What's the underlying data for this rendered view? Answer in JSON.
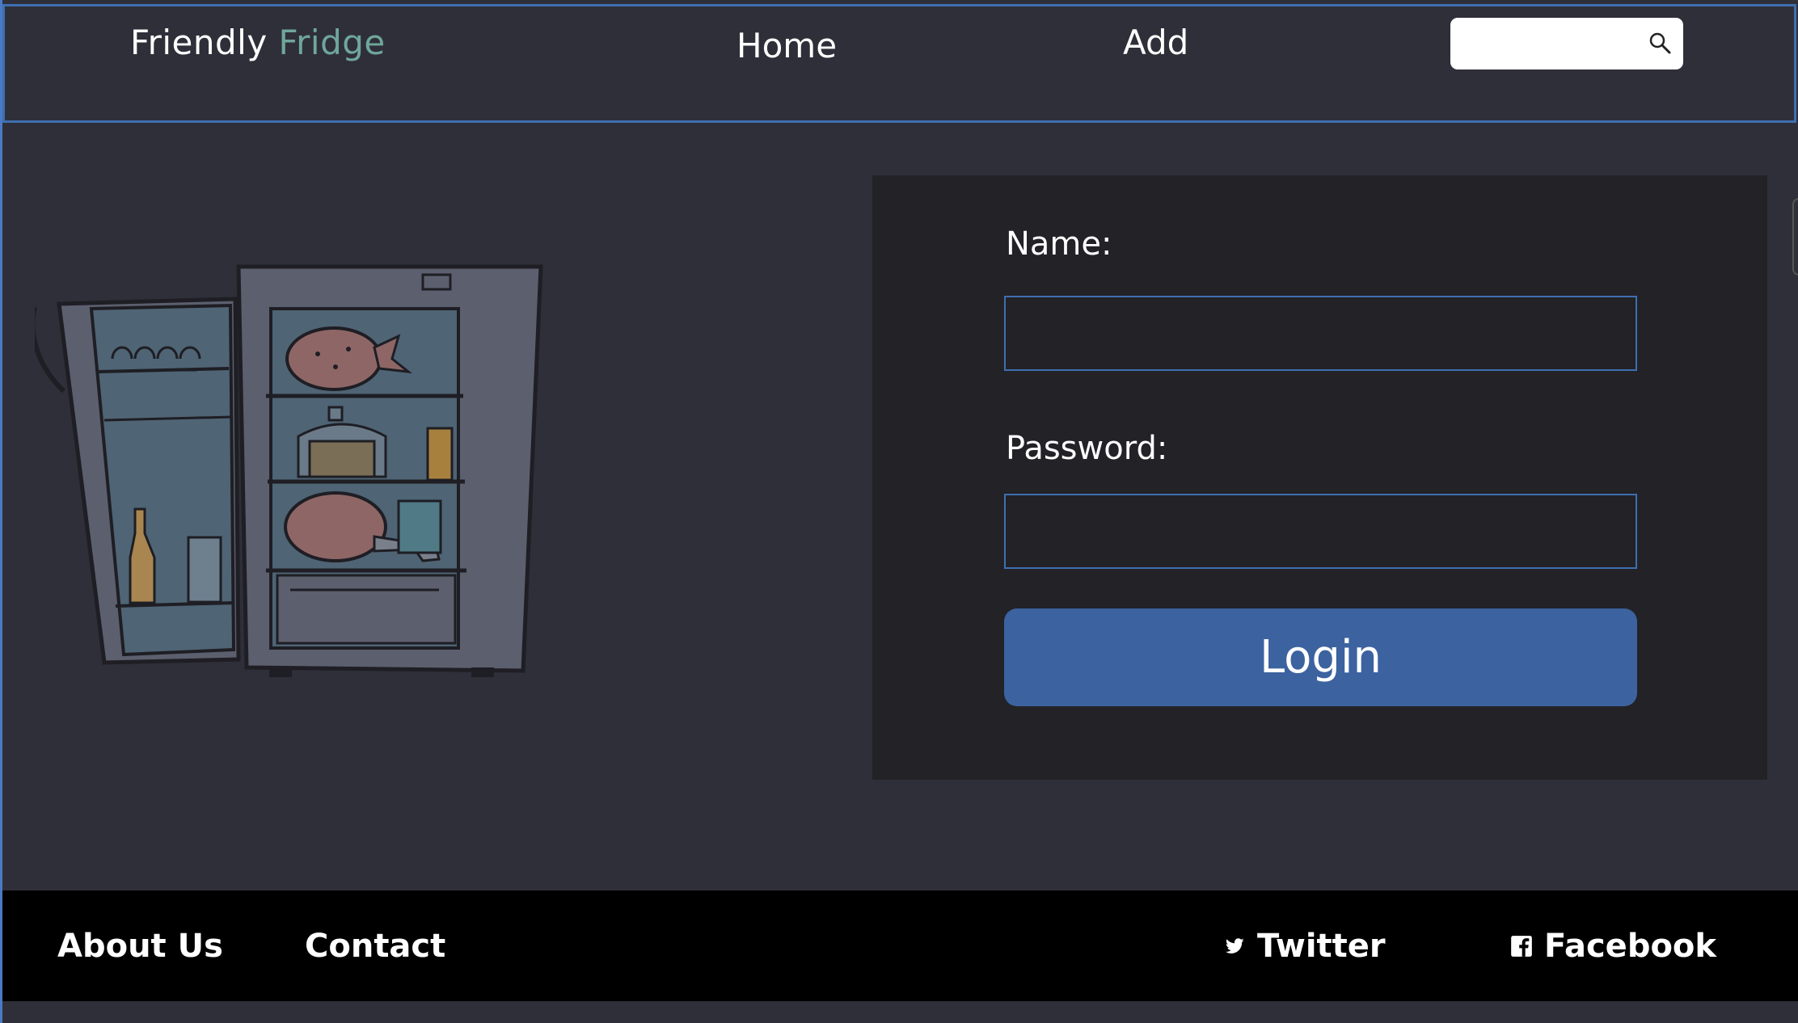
{
  "header": {
    "brand_first": "Friendly",
    "brand_second": "Fridge",
    "nav_home": "Home",
    "nav_add": "Add",
    "search": {
      "value": "",
      "placeholder": "",
      "icon": "search-icon"
    }
  },
  "login": {
    "name_label": "Name:",
    "name_value": "",
    "password_label": "Password:",
    "password_value": "",
    "button_label": "Login"
  },
  "footer": {
    "about": "About Us",
    "contact": "Contact",
    "twitter": "Twitter",
    "facebook": "Facebook",
    "twitter_icon": "twitter-icon",
    "facebook_icon": "facebook-icon"
  },
  "colors": {
    "background": "#2f2f3a",
    "panel": "#222227",
    "accent_blue": "#3c62a0",
    "brand_accent": "#6fa79a",
    "footer": "#000000"
  }
}
